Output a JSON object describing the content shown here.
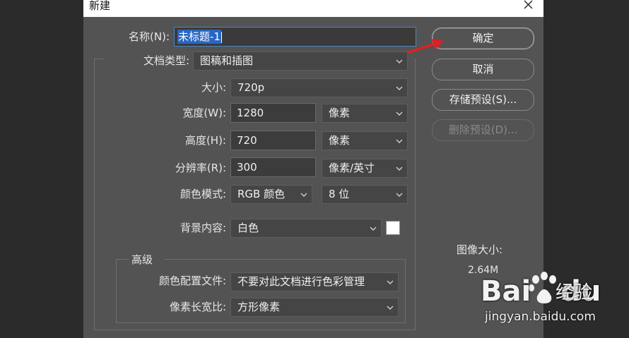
{
  "dialog": {
    "title": "新建"
  },
  "form": {
    "name_label": "名称(N):",
    "name_value": "未标题-1",
    "doc_type_label": "文档类型:",
    "doc_type_value": "图稿和插图",
    "size_label": "大小:",
    "size_value": "720p",
    "width_label": "宽度(W):",
    "width_value": "1280",
    "width_unit": "像素",
    "height_label": "高度(H):",
    "height_value": "720",
    "height_unit": "像素",
    "resolution_label": "分辨率(R):",
    "resolution_value": "300",
    "resolution_unit": "像素/英寸",
    "color_mode_label": "颜色模式:",
    "color_mode_value": "RGB 颜色",
    "bit_depth_value": "8 位",
    "background_label": "背景内容:",
    "background_value": "白色",
    "background_swatch_color": "#ffffff"
  },
  "advanced": {
    "title": "高级",
    "profile_label": "颜色配置文件:",
    "profile_value": "不要对此文档进行色彩管理",
    "aspect_label": "像素长宽比:",
    "aspect_value": "方形像素"
  },
  "buttons": {
    "ok": "确定",
    "cancel": "取消",
    "save_preset": "存储预设(S)...",
    "delete_preset": "删除预设(D)..."
  },
  "image_size": {
    "label": "图像大小:",
    "value": "2.64M"
  },
  "watermark": {
    "brand_text": "Bai",
    "brand_text2": "du",
    "brand_cn": "经验",
    "url": "jingyan.baidu.com"
  },
  "colors": {
    "selection": "#2a66c2",
    "arrow": "#e02020",
    "dialog_bg": "#535353"
  }
}
